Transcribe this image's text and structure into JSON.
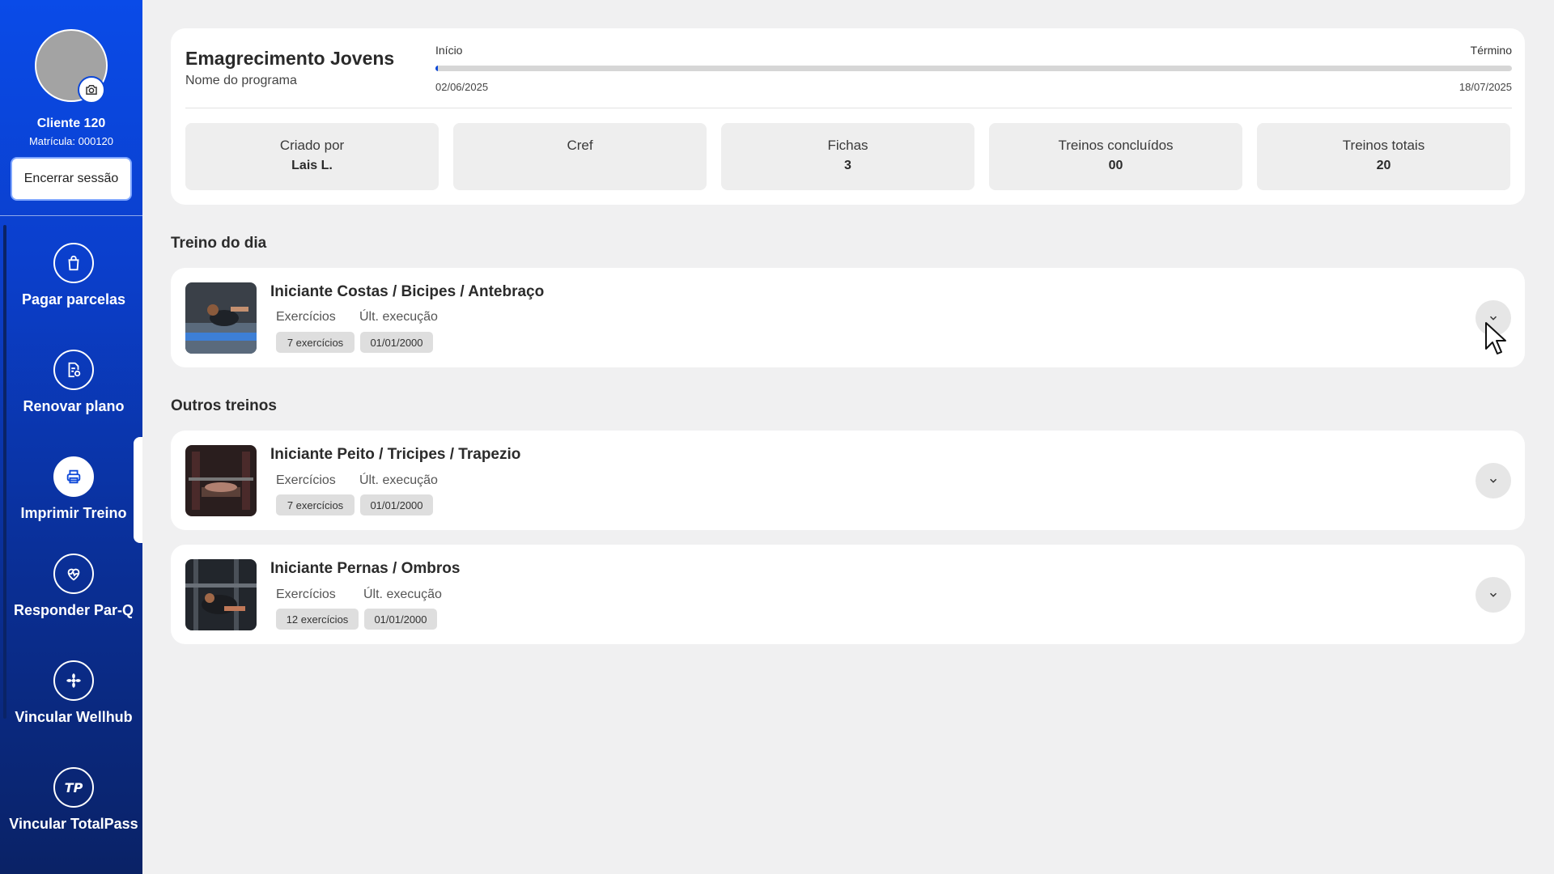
{
  "sidebar": {
    "client_name": "Cliente 120",
    "client_registration": "Matrícula: 000120",
    "logout_label": "Encerrar sessão",
    "items": [
      {
        "label": "Pagar parcelas",
        "icon": "shopping-bag-icon"
      },
      {
        "label": "Renovar plano",
        "icon": "document-refresh-icon"
      },
      {
        "label": "Imprimir Treino",
        "icon": "printer-icon",
        "active": true
      },
      {
        "label": "Responder Par-Q",
        "icon": "heart-pulse-icon"
      },
      {
        "label": "Vincular Wellhub",
        "icon": "wellhub-icon"
      },
      {
        "label": "Vincular TotalPass",
        "icon": "totalpass-icon"
      }
    ]
  },
  "program": {
    "name": "Emagrecimento Jovens",
    "name_label": "Nome do programa",
    "start_label": "Início",
    "end_label": "Término",
    "start_date": "02/06/2025",
    "end_date": "18/07/2025",
    "progress": 0.002,
    "stats": [
      {
        "label": "Criado por",
        "value": "Lais L."
      },
      {
        "label": "Cref",
        "value": ""
      },
      {
        "label": "Fichas",
        "value": "3"
      },
      {
        "label": "Treinos concluídos",
        "value": "00"
      },
      {
        "label": "Treinos totais",
        "value": "20"
      }
    ]
  },
  "today": {
    "section_title": "Treino do dia",
    "workouts": [
      {
        "title": "Iniciante Costas / Bicipes / Antebraço",
        "exercises_label": "Exercícios",
        "last_exec_label": "Últ. execução",
        "exercises": "7 exercícios",
        "last_exec": "01/01/2000"
      }
    ]
  },
  "others": {
    "section_title": "Outros treinos",
    "workouts": [
      {
        "title": "Iniciante Peito / Tricipes / Trapezio",
        "exercises_label": "Exercícios",
        "last_exec_label": "Últ. execução",
        "exercises": "7 exercícios",
        "last_exec": "01/01/2000"
      },
      {
        "title": "Iniciante Pernas / Ombros",
        "exercises_label": "Exercícios",
        "last_exec_label": "Últ. execução",
        "exercises": "12 exercícios",
        "last_exec": "01/01/2000"
      }
    ]
  },
  "colors": {
    "brand_blue": "#0b47d8",
    "sidebar_dark": "#0a2266",
    "background": "#f0f0f1"
  }
}
